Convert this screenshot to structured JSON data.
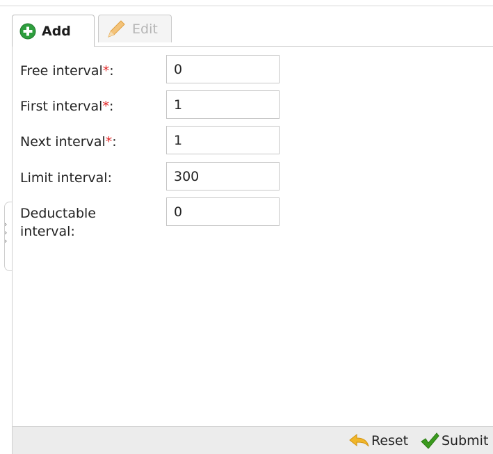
{
  "tabs": {
    "add_label": "Add",
    "edit_label": "Edit"
  },
  "form": {
    "fields": [
      {
        "label": "Free interval",
        "required": "*",
        "suffix": ":",
        "value": "0"
      },
      {
        "label": "First interval",
        "required": "*",
        "suffix": ":",
        "value": "1"
      },
      {
        "label": "Next interval",
        "required": "*",
        "suffix": ":",
        "value": "1"
      },
      {
        "label": "Limit interval:",
        "value": "300"
      },
      {
        "label": "Deductable interval:",
        "value": "0"
      }
    ]
  },
  "footer": {
    "reset_label": "Reset",
    "submit_label": "Submit"
  },
  "icons": {
    "add": "plus-circle-icon",
    "edit": "pencil-icon",
    "reset": "undo-arrow-icon",
    "submit": "checkmark-icon",
    "collapse": "chevron-right-icon"
  },
  "colors": {
    "required_asterisk": "#e02020",
    "add_icon": "#2e9e3e",
    "submit_check": "#3a9a1e",
    "reset_arrow": "#f0b62a"
  }
}
